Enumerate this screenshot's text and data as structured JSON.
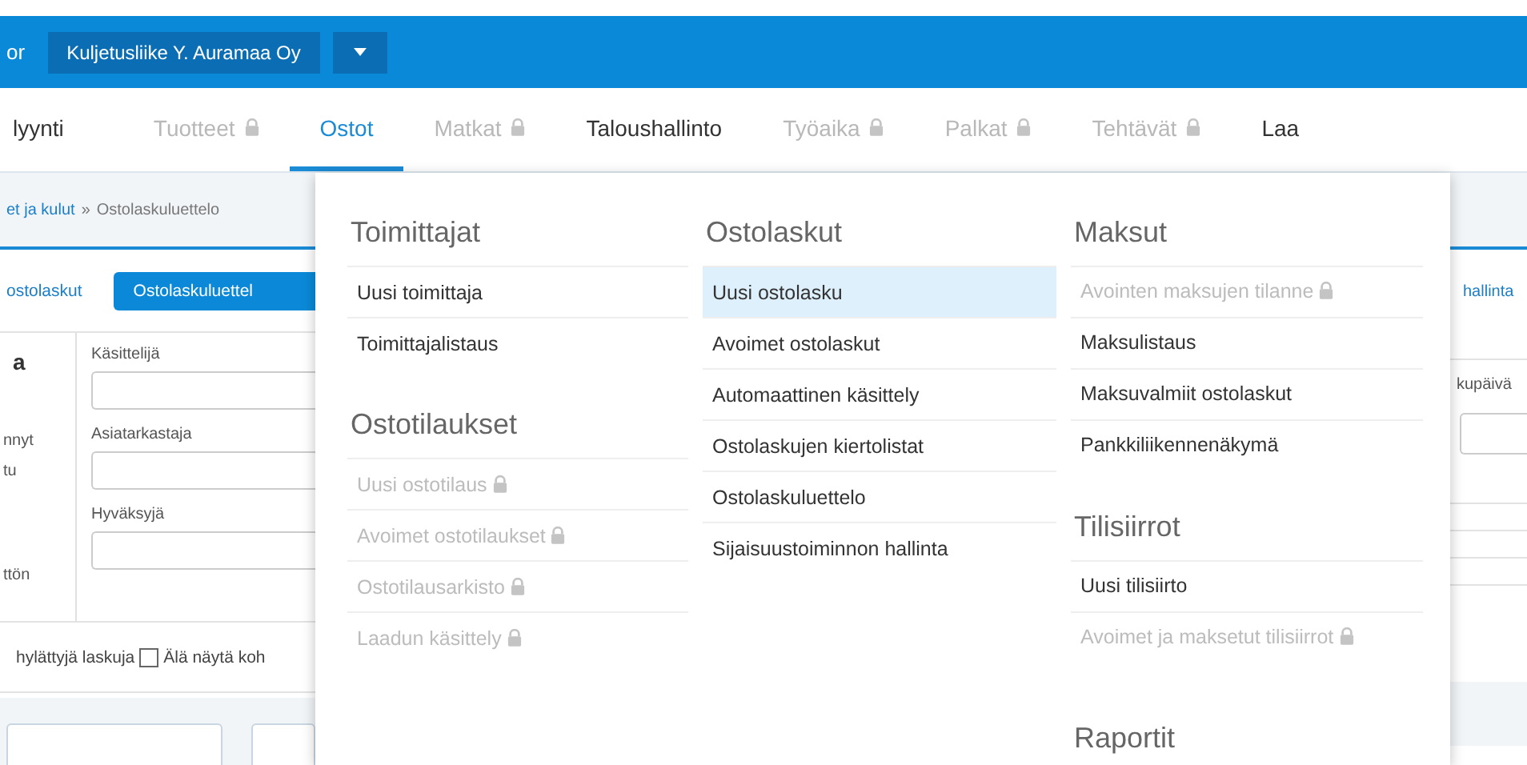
{
  "top_bar": {
    "title_fragment": "or",
    "company": "Kuljetusliike Y. Auramaa Oy"
  },
  "nav_tabs": [
    {
      "label": "lyynti",
      "locked": false,
      "selected": false
    },
    {
      "label": "Tuotteet",
      "locked": true,
      "selected": false
    },
    {
      "label": "Ostot",
      "locked": false,
      "selected": true
    },
    {
      "label": "Matkat",
      "locked": true,
      "selected": false
    },
    {
      "label": "Taloushallinto",
      "locked": false,
      "selected": false
    },
    {
      "label": "Työaika",
      "locked": true,
      "selected": false
    },
    {
      "label": "Palkat",
      "locked": true,
      "selected": false
    },
    {
      "label": "Tehtävät",
      "locked": true,
      "selected": false
    },
    {
      "label": "Laa",
      "locked": false,
      "selected": false
    }
  ],
  "page": {
    "breadcrumb": {
      "link": "et ja kulut",
      "separator": "»",
      "current": "Ostolaskuluettelo"
    },
    "subtabs": [
      {
        "label": "ostolaskut",
        "selected": false
      },
      {
        "label": "Ostolaskuluettel",
        "selected": true
      }
    ],
    "side_labels": [
      {
        "kind": "heading",
        "text": "a"
      },
      {
        "kind": "option",
        "text": "nnyt"
      },
      {
        "kind": "option",
        "text": "tu"
      },
      {
        "kind": "option",
        "text": "ttön"
      }
    ],
    "fields": [
      {
        "label": "Käsittelijä"
      },
      {
        "label": "Asiatarkastaja"
      },
      {
        "label": "Hyväksyjä"
      }
    ],
    "filter_row": {
      "text_fragment": "hylättyjä laskuja",
      "checkbox": {
        "label": "Älä näytä koh",
        "checked": false
      }
    },
    "right_strip": {
      "link": "hallinta",
      "field_label": "kupäivä"
    }
  },
  "menu": {
    "columns": [
      {
        "sections": [
          {
            "heading": "Toimittajat",
            "items": [
              {
                "label": "Uusi toimittaja",
                "locked": false,
                "selected": false
              },
              {
                "label": "Toimittajalistaus",
                "locked": false,
                "selected": false
              }
            ]
          },
          {
            "heading": "Ostotilaukset",
            "items": [
              {
                "label": "Uusi ostotilaus",
                "locked": true,
                "selected": false
              },
              {
                "label": "Avoimet ostotilaukset",
                "locked": true,
                "selected": false
              },
              {
                "label": "Ostotilausarkisto",
                "locked": true,
                "selected": false
              },
              {
                "label": "Laadun käsittely",
                "locked": true,
                "selected": false
              }
            ]
          }
        ]
      },
      {
        "sections": [
          {
            "heading": "Ostolaskut",
            "items": [
              {
                "label": "Uusi ostolasku",
                "locked": false,
                "selected": true
              },
              {
                "label": "Avoimet ostolaskut",
                "locked": false,
                "selected": false
              },
              {
                "label": "Automaattinen käsittely",
                "locked": false,
                "selected": false
              },
              {
                "label": "Ostolaskujen kiertolistat",
                "locked": false,
                "selected": false
              },
              {
                "label": "Ostolaskuluettelo",
                "locked": false,
                "selected": false
              },
              {
                "label": "Sijaisuustoiminnon hallinta",
                "locked": false,
                "selected": false
              }
            ]
          }
        ]
      },
      {
        "sections": [
          {
            "heading": "Maksut",
            "items": [
              {
                "label": "Avointen maksujen tilanne",
                "locked": true,
                "selected": false
              },
              {
                "label": "Maksulistaus",
                "locked": false,
                "selected": false
              },
              {
                "label": "Maksuvalmiit ostolaskut",
                "locked": false,
                "selected": false
              },
              {
                "label": "Pankkiliikennenäkymä",
                "locked": false,
                "selected": false
              }
            ]
          },
          {
            "heading": "Tilisiirrot",
            "items": [
              {
                "label": "Uusi tilisiirto",
                "locked": false,
                "selected": false
              },
              {
                "label": "Avoimet ja maksetut tilisiirrot",
                "locked": true,
                "selected": false
              }
            ]
          },
          {
            "heading": "Raportit"
          }
        ]
      }
    ]
  }
}
